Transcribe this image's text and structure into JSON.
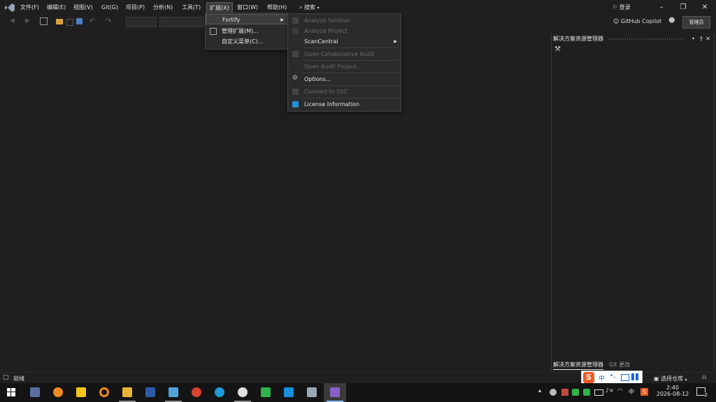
{
  "menubar": {
    "items": [
      "文件(F)",
      "编辑(E)",
      "视图(V)",
      "Git(G)",
      "项目(P)",
      "分析(N)",
      "工具(T)",
      "扩展(X)",
      "窗口(W)",
      "帮助(H)"
    ],
    "search": "搜索",
    "login": "登录"
  },
  "toolbar": {
    "copilot": "GitHub Copilot",
    "admin": "管理员"
  },
  "extensions_menu": {
    "items": [
      {
        "label": "Fortify",
        "has_submenu": true,
        "highlighted": true
      },
      {
        "label": "管理扩展(M)...",
        "icon": "manage-extensions-icon"
      },
      {
        "label": "自定义菜单(C)..."
      }
    ]
  },
  "fortify_menu": {
    "items": [
      {
        "label": "Analyze Solution",
        "enabled": false
      },
      {
        "label": "Analyze Project",
        "enabled": false
      },
      {
        "label": "ScanCentral",
        "enabled": true,
        "has_submenu": true
      },
      {
        "label": "Open Collaborative Audit",
        "enabled": false
      },
      {
        "label": "Open Audit Project...",
        "enabled": false
      },
      {
        "label": "Options...",
        "enabled": true,
        "icon": "gear-icon"
      },
      {
        "label": "Connect to SSC",
        "enabled": false
      },
      {
        "label": "License Information",
        "enabled": true,
        "icon": "license-icon"
      }
    ]
  },
  "solution_explorer": {
    "title": "解决方案资源管理器",
    "tab_active": "解决方案资源管理器",
    "tab_other": "Git 更改"
  },
  "statusbar": {
    "text": "就绪",
    "repo": "选择仓库"
  },
  "taskbar": {
    "ime": "中",
    "tray_lang": "中",
    "time": "2:40",
    "date": "2026-08-12",
    "notifications": "2"
  },
  "colors": {
    "background": "#1f1f1f",
    "vs_purple": "#8661c5",
    "license_blue": "#1f8fd6",
    "sogou_orange": "#f25a22"
  }
}
